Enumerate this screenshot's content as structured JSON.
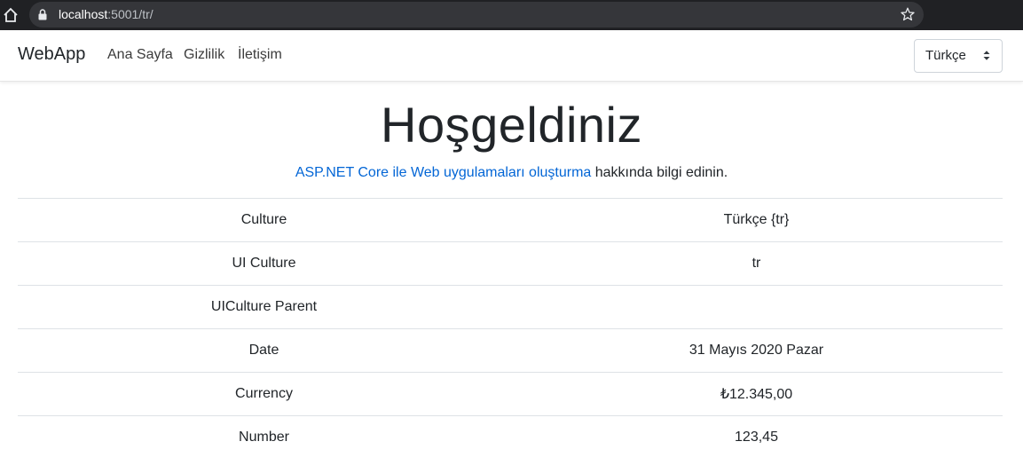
{
  "browser": {
    "url_host": "localhost",
    "url_path": ":5001/tr/"
  },
  "navbar": {
    "brand": "WebApp",
    "links": [
      "Ana Sayfa",
      "Gizlilik",
      "İletişim"
    ],
    "language_select": {
      "selected": "Türkçe"
    }
  },
  "main": {
    "title": "Hoşgeldiniz",
    "intro_link": "ASP.NET Core ile Web uygulamaları oluşturma",
    "intro_rest": " hakkında bilgi edinin."
  },
  "table": {
    "rows": [
      {
        "label": "Culture",
        "value": "Türkçe {tr}"
      },
      {
        "label": "UI Culture",
        "value": "tr"
      },
      {
        "label": "UICulture Parent",
        "value": ""
      },
      {
        "label": "Date",
        "value": "31 Mayıs 2020 Pazar"
      },
      {
        "label": "Currency",
        "value": "₺12.345,00"
      },
      {
        "label": "Number",
        "value": "123,45"
      }
    ]
  },
  "colors": {
    "link": "#0366d6",
    "chrome_bg": "#202124",
    "omnibox_bg": "#35363a"
  }
}
